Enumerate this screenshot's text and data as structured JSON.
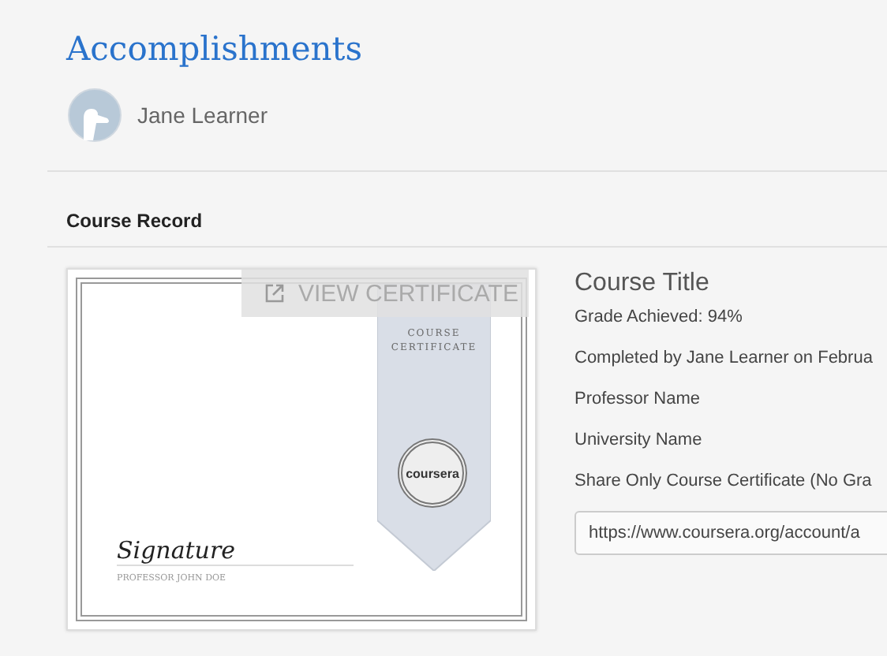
{
  "page": {
    "title": "Accomplishments"
  },
  "profile": {
    "name": "Jane Learner"
  },
  "section": {
    "title": "Course Record"
  },
  "certificate": {
    "overlay_button": "VIEW CERTIFICATE",
    "ribbon_lines": [
      "COURSE",
      "CERTIFICATE"
    ],
    "seal_text": "coursera",
    "signature": "Signature",
    "signer": "PROFESSOR JOHN DOE"
  },
  "course": {
    "title": "Course Title",
    "details": [
      "Grade Achieved: 94%",
      "Completed by Jane Learner on Februa",
      "Professor Name",
      "University Name",
      "Share Only Course Certificate (No Gra"
    ],
    "share_link": "https://www.coursera.org/account/a"
  }
}
